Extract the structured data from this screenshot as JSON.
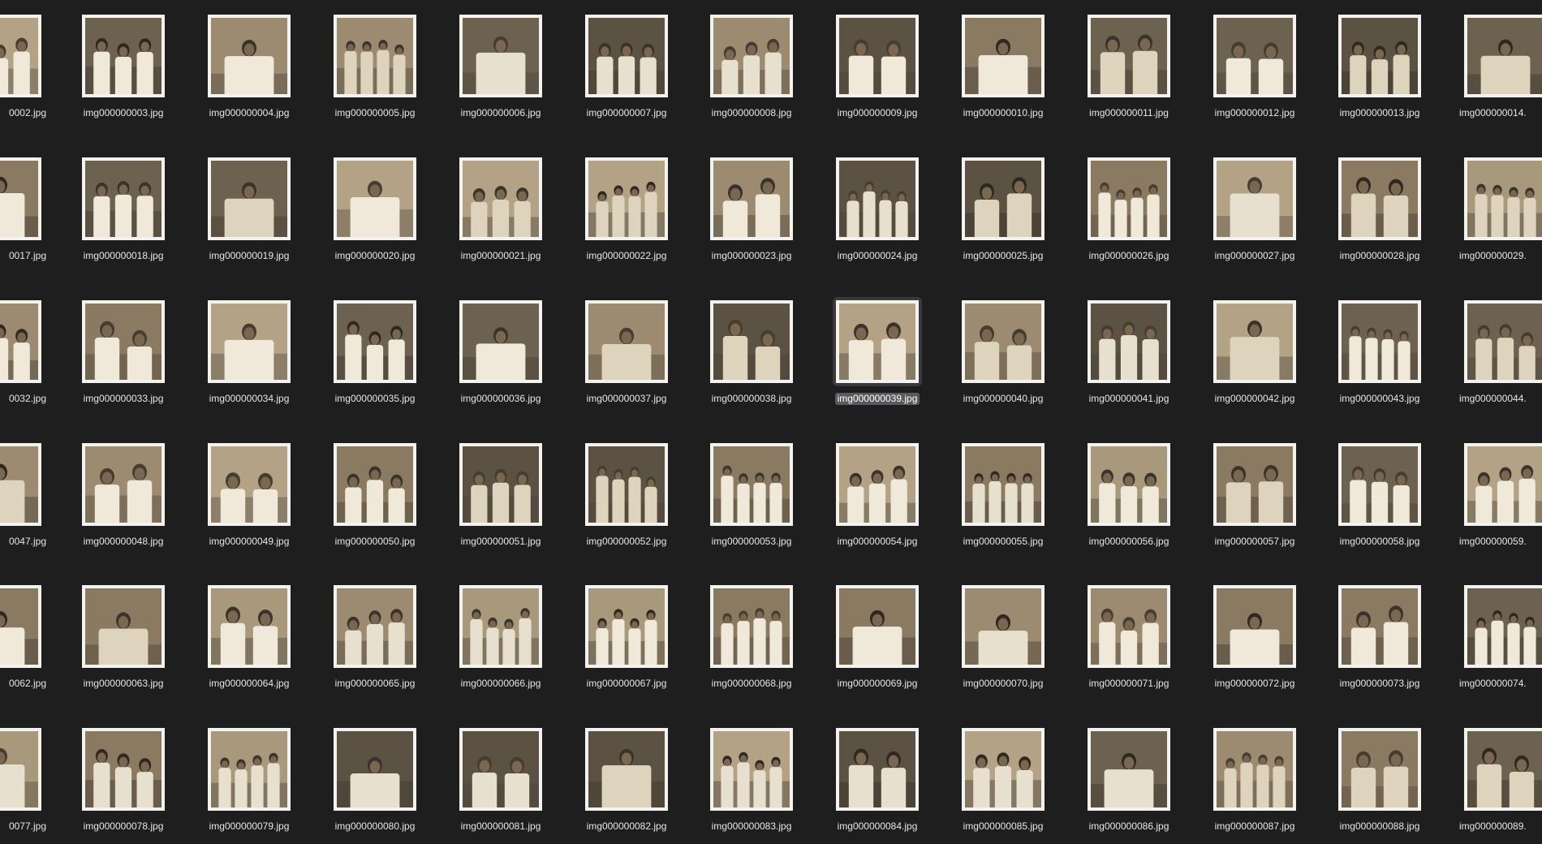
{
  "view": {
    "selected_file": "img000000039.jpg",
    "columns_visible": 13,
    "rows_visible": 6
  },
  "colors": {
    "background": "#1e1e1e",
    "photo_border": "#f4f2ee",
    "selection_bg": "#3a3a3c",
    "label_text": "#e6e6e6"
  },
  "files": [
    [
      "0002.jpg",
      "img000000003.jpg",
      "img000000004.jpg",
      "img000000005.jpg",
      "img000000006.jpg",
      "img000000007.jpg",
      "img000000008.jpg",
      "img000000009.jpg",
      "img000000010.jpg",
      "img000000011.jpg",
      "img000000012.jpg",
      "img000000013.jpg",
      "img000000014."
    ],
    [
      "0017.jpg",
      "img000000018.jpg",
      "img000000019.jpg",
      "img000000020.jpg",
      "img000000021.jpg",
      "img000000022.jpg",
      "img000000023.jpg",
      "img000000024.jpg",
      "img000000025.jpg",
      "img000000026.jpg",
      "img000000027.jpg",
      "img000000028.jpg",
      "img000000029."
    ],
    [
      "0032.jpg",
      "img000000033.jpg",
      "img000000034.jpg",
      "img000000035.jpg",
      "img000000036.jpg",
      "img000000037.jpg",
      "img000000038.jpg",
      "img000000039.jpg",
      "img000000040.jpg",
      "img000000041.jpg",
      "img000000042.jpg",
      "img000000043.jpg",
      "img000000044."
    ],
    [
      "0047.jpg",
      "img000000048.jpg",
      "img000000049.jpg",
      "img000000050.jpg",
      "img000000051.jpg",
      "img000000052.jpg",
      "img000000053.jpg",
      "img000000054.jpg",
      "img000000055.jpg",
      "img000000056.jpg",
      "img000000057.jpg",
      "img000000058.jpg",
      "img000000059."
    ],
    [
      "0062.jpg",
      "img000000063.jpg",
      "img000000064.jpg",
      "img000000065.jpg",
      "img000000066.jpg",
      "img000000067.jpg",
      "img000000068.jpg",
      "img000000069.jpg",
      "img000000070.jpg",
      "img000000071.jpg",
      "img000000072.jpg",
      "img000000073.jpg",
      "img000000074."
    ],
    [
      "0077.jpg",
      "img000000078.jpg",
      "img000000079.jpg",
      "img000000080.jpg",
      "img000000081.jpg",
      "img000000082.jpg",
      "img000000083.jpg",
      "img000000084.jpg",
      "img000000085.jpg",
      "img000000086.jpg",
      "img000000087.jpg",
      "img000000088.jpg",
      "img000000089."
    ]
  ]
}
